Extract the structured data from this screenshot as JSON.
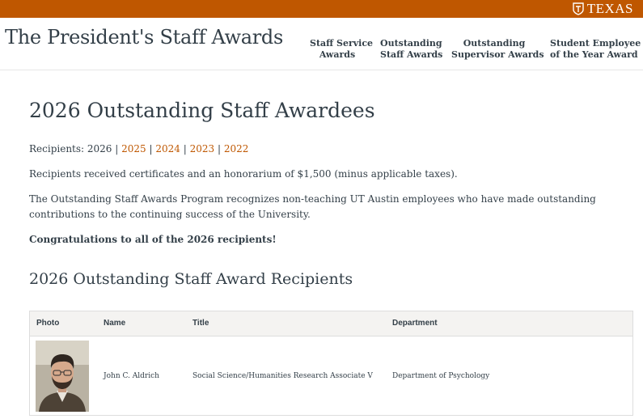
{
  "brand": {
    "label": "TEXAS",
    "icon": "longhorn-seal-icon",
    "bar_color": "#bf5700"
  },
  "site": {
    "title": "The President's Staff Awards"
  },
  "nav": [
    {
      "line1": "Staff Service",
      "line2": "Awards"
    },
    {
      "line1": "Outstanding",
      "line2": "Staff Awards"
    },
    {
      "line1": "Outstanding",
      "line2": "Supervisor Awards"
    },
    {
      "line1": "Student Employee",
      "line2": "of the Year Award"
    }
  ],
  "main": {
    "title": "2026 Outstanding Staff Awardees",
    "recipients": {
      "label": "Recipients: 2026",
      "separator": "|",
      "years": [
        "2025",
        "2024",
        "2023",
        "2022"
      ]
    },
    "honorarium": "Recipients received certificates and an honorarium of $1,500 (minus applicable taxes).",
    "description": "The Outstanding Staff Awards Program recognizes non-teaching UT Austin employees who have made outstanding contributions to the continuing success of the University.",
    "congrats": "Congratulations to all of the 2026 recipients!",
    "section_title": "2026 Outstanding Staff Award Recipients",
    "table": {
      "headers": [
        "Photo",
        "Name",
        "Title",
        "Department"
      ],
      "rows": [
        {
          "name": "John C. Aldrich",
          "title": "Social Science/Humanities Research Associate V",
          "department": "Department of Psychology"
        }
      ]
    }
  },
  "colors": {
    "accent": "#bf5700",
    "text": "#333f48",
    "table_header_bg": "#f4f3f1"
  }
}
